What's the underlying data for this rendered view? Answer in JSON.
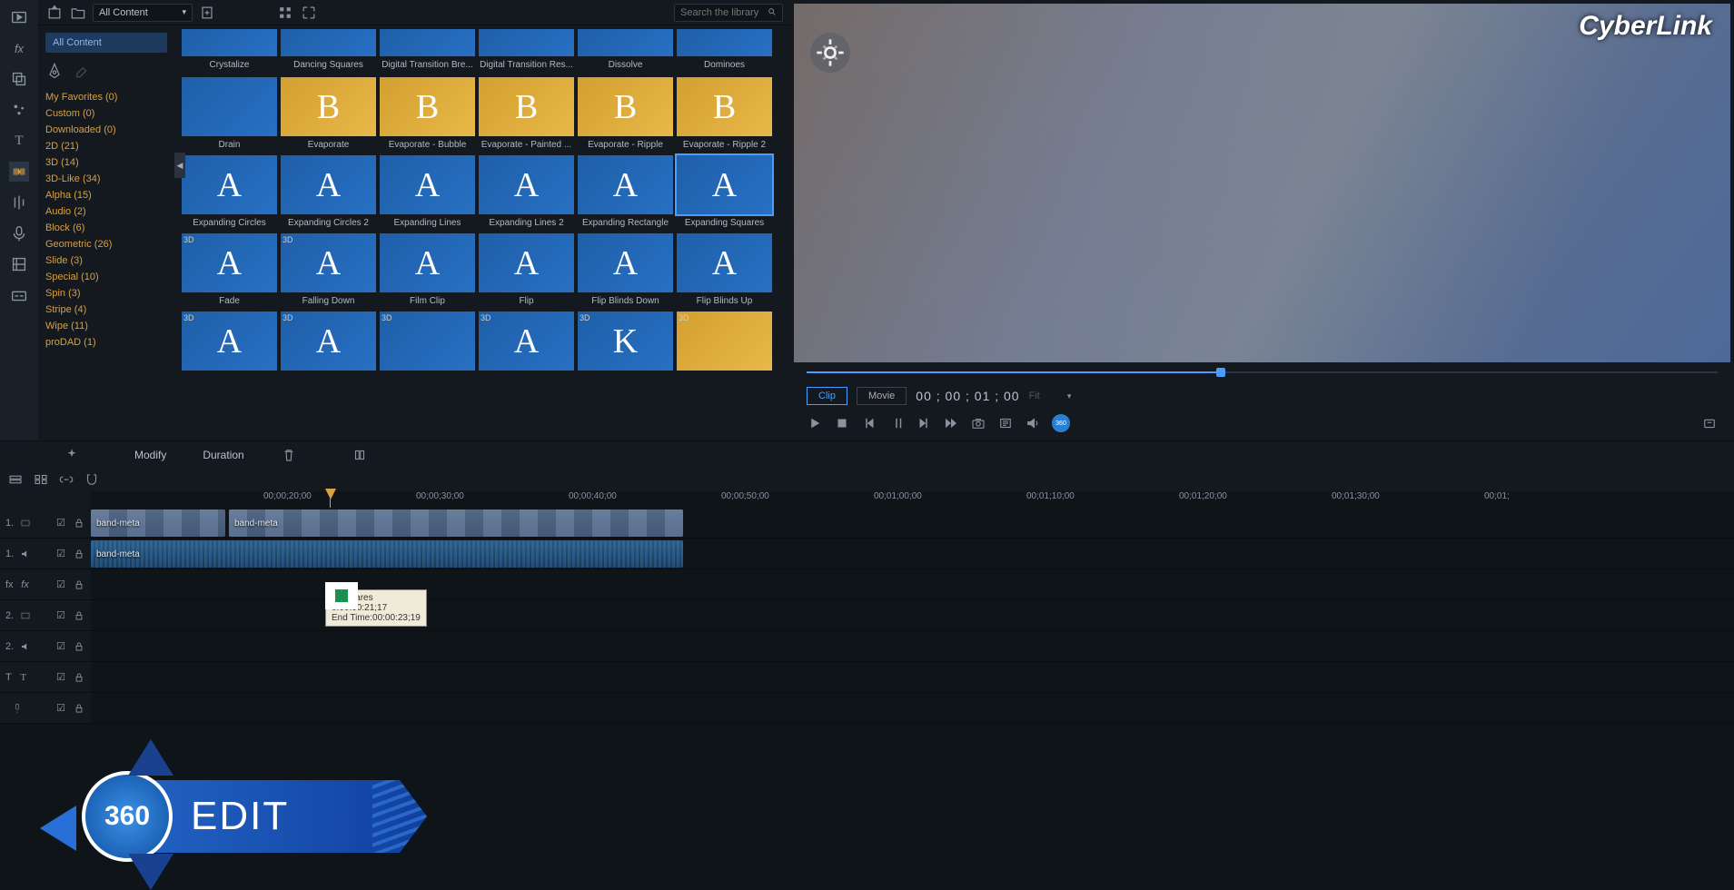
{
  "library": {
    "dropdown": "All Content",
    "search_placeholder": "Search the library",
    "side_tag": "All Content",
    "categories": [
      {
        "label": "My Favorites",
        "count": 0
      },
      {
        "label": "Custom",
        "count": 0
      },
      {
        "label": "Downloaded",
        "count": 0
      },
      {
        "label": "2D",
        "count": 21
      },
      {
        "label": "3D",
        "count": 14
      },
      {
        "label": "3D-Like",
        "count": 34
      },
      {
        "label": "Alpha",
        "count": 15
      },
      {
        "label": "Audio",
        "count": 2
      },
      {
        "label": "Block",
        "count": 6
      },
      {
        "label": "Geometric",
        "count": 26
      },
      {
        "label": "Slide",
        "count": 3
      },
      {
        "label": "Special",
        "count": 10
      },
      {
        "label": "Spin",
        "count": 3
      },
      {
        "label": "Stripe",
        "count": 4
      },
      {
        "label": "Wipe",
        "count": 11
      },
      {
        "label": "proDAD",
        "count": 1
      }
    ],
    "items_row0": [
      "Crystalize",
      "Dancing Squares",
      "Digital Transition Bre...",
      "Digital Transition Res...",
      "Dissolve",
      "Dominoes"
    ],
    "items": [
      {
        "label": "Drain",
        "letter": "",
        "style": "blue"
      },
      {
        "label": "Evaporate",
        "letter": "B",
        "style": "gold"
      },
      {
        "label": "Evaporate - Bubble",
        "letter": "B",
        "style": "gold"
      },
      {
        "label": "Evaporate - Painted ...",
        "letter": "B",
        "style": "gold"
      },
      {
        "label": "Evaporate - Ripple",
        "letter": "B",
        "style": "gold"
      },
      {
        "label": "Evaporate - Ripple 2",
        "letter": "B",
        "style": "gold"
      },
      {
        "label": "Expanding Circles",
        "letter": "A",
        "style": "blue"
      },
      {
        "label": "Expanding Circles 2",
        "letter": "A",
        "style": "blue"
      },
      {
        "label": "Expanding Lines",
        "letter": "A",
        "style": "blue"
      },
      {
        "label": "Expanding Lines 2",
        "letter": "A",
        "style": "blue"
      },
      {
        "label": "Expanding Rectangle",
        "letter": "A",
        "style": "blue"
      },
      {
        "label": "Expanding Squares",
        "letter": "A",
        "style": "blue",
        "selected": true
      },
      {
        "label": "Fade",
        "letter": "A",
        "style": "blue",
        "tag": "3D"
      },
      {
        "label": "Falling Down",
        "letter": "A",
        "style": "blue",
        "tag": "3D"
      },
      {
        "label": "Film Clip",
        "letter": "A",
        "style": "blue"
      },
      {
        "label": "Flip",
        "letter": "A",
        "style": "blue"
      },
      {
        "label": "Flip Blinds Down",
        "letter": "A",
        "style": "blue"
      },
      {
        "label": "Flip Blinds Up",
        "letter": "A",
        "style": "blue"
      },
      {
        "label": "",
        "letter": "A",
        "style": "blue",
        "tag": "3D"
      },
      {
        "label": "",
        "letter": "A",
        "style": "blue",
        "tag": "3D"
      },
      {
        "label": "",
        "letter": "",
        "style": "blue",
        "tag": "3D"
      },
      {
        "label": "",
        "letter": "A",
        "style": "blue",
        "tag": "3D"
      },
      {
        "label": "",
        "letter": "K",
        "style": "blue",
        "tag": "3D"
      },
      {
        "label": "",
        "letter": "",
        "style": "gold",
        "tag": "3D"
      }
    ]
  },
  "preview": {
    "brand": "CyberLink",
    "mode_clip": "Clip",
    "mode_movie": "Movie",
    "timecode": "00 ; 00 ; 01 ; 00",
    "fit": "Fit"
  },
  "midbar": {
    "modify": "Modify",
    "duration": "Duration"
  },
  "timeline": {
    "ticks": [
      "00;00;20;00",
      "00;00;30;00",
      "00;00;40;00",
      "00;00;50;00",
      "00;01;00;00",
      "00;01;10;00",
      "00;01;20;00",
      "00;01;30;00",
      "00;01;"
    ],
    "tracks": [
      {
        "num": "1.",
        "icon": "video"
      },
      {
        "num": "1.",
        "icon": "audio"
      },
      {
        "num": "fx",
        "icon": "fx"
      },
      {
        "num": "2.",
        "icon": "video"
      },
      {
        "num": "2.",
        "icon": "audio"
      },
      {
        "num": "T",
        "icon": "title"
      },
      {
        "num": "",
        "icon": "mic"
      }
    ],
    "clip_video": "band-meta",
    "clip_video2": "band-meta",
    "clip_audio": "band-meta",
    "tooltip_name": "g Squares",
    "tooltip_start": "e:00:00:21;17",
    "tooltip_end": "End Time:00:00:23;19"
  },
  "badge": {
    "num": "360",
    "word": "EDIT"
  }
}
